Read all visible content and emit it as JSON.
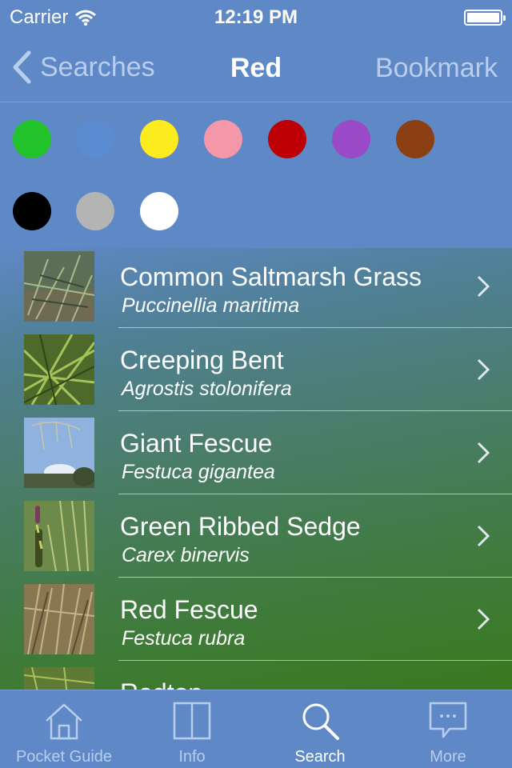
{
  "status_bar": {
    "carrier": "Carrier",
    "time": "12:19 PM",
    "battery_level": 1.0
  },
  "nav": {
    "back_label": "Searches",
    "title": "Red",
    "right_label": "Bookmark"
  },
  "swatches": [
    {
      "name": "green",
      "color": "#22c22a"
    },
    {
      "name": "blue",
      "color": "#5b8bd0"
    },
    {
      "name": "yellow",
      "color": "#fceb1f"
    },
    {
      "name": "pink",
      "color": "#f497a8"
    },
    {
      "name": "red",
      "color": "#bd0006"
    },
    {
      "name": "purple",
      "color": "#9a4ac6"
    },
    {
      "name": "brown",
      "color": "#8b3f12"
    },
    {
      "name": "black",
      "color": "#000000"
    },
    {
      "name": "grey",
      "color": "#b4b4b4"
    },
    {
      "name": "white",
      "color": "#ffffff"
    }
  ],
  "list": {
    "items": [
      {
        "common": "Common Saltmarsh Grass",
        "latin": "Puccinellia maritima",
        "thumb_icon": "grass-photo"
      },
      {
        "common": "Creeping Bent",
        "latin": "Agrostis stolonifera",
        "thumb_icon": "grass-photo"
      },
      {
        "common": "Giant Fescue",
        "latin": "Festuca gigantea",
        "thumb_icon": "grass-sky-photo"
      },
      {
        "common": "Green Ribbed Sedge",
        "latin": "Carex binervis",
        "thumb_icon": "sedge-photo"
      },
      {
        "common": "Red Fescue",
        "latin": "Festuca rubra",
        "thumb_icon": "dry-grass-photo"
      },
      {
        "common": "Redtop",
        "latin": "",
        "thumb_icon": "grass-photo"
      }
    ]
  },
  "tab_bar": {
    "tabs": [
      {
        "label": "Pocket Guide",
        "icon": "home-icon",
        "active": false
      },
      {
        "label": "Info",
        "icon": "book-icon",
        "active": false
      },
      {
        "label": "Search",
        "icon": "search-icon",
        "active": true
      },
      {
        "label": "More",
        "icon": "chat-bubble-icon",
        "active": false
      }
    ]
  },
  "colors": {
    "accent": "#5f88c6",
    "inactive_text": "#b9cdee",
    "active_text": "#ffffff"
  }
}
